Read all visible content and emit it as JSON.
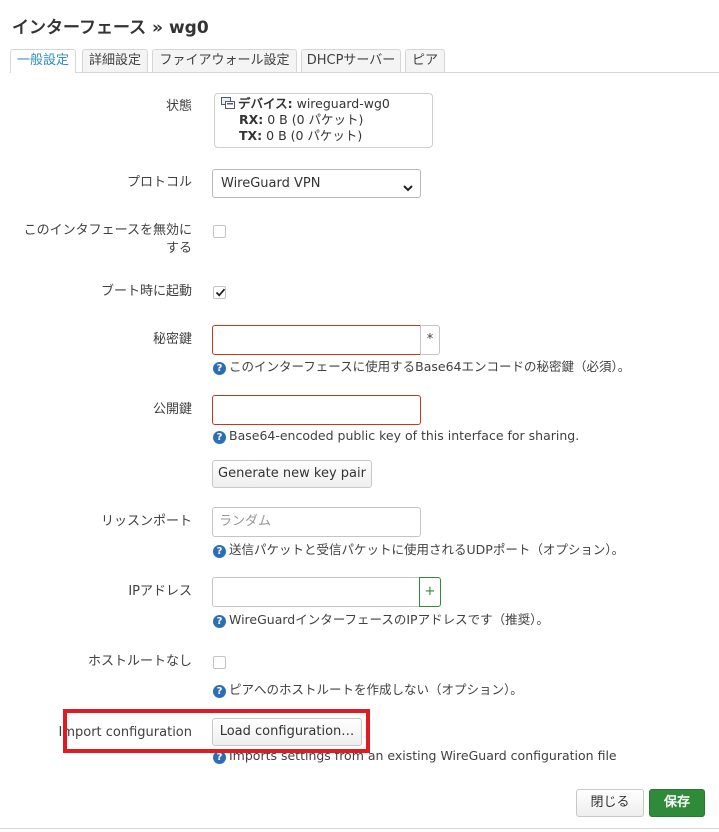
{
  "title": "インターフェース » wg0",
  "tabs": [
    {
      "label": "一般設定",
      "active": true
    },
    {
      "label": "詳細設定",
      "active": false
    },
    {
      "label": "ファイアウォール設定",
      "active": false
    },
    {
      "label": "DHCPサーバー",
      "active": false
    },
    {
      "label": "ピア",
      "active": false
    }
  ],
  "status": {
    "label": "状態",
    "device_key": "デバイス:",
    "device_value": "wireguard-wg0",
    "rx_key": "RX:",
    "rx_value": "0 B (0 パケット)",
    "tx_key": "TX:",
    "tx_value": "0 B (0 パケット)",
    "icon": "network-device-icon"
  },
  "protocol": {
    "label": "プロトコル",
    "value": "WireGuard VPN"
  },
  "disable": {
    "label_line1": "このインタフェースを無効に",
    "label_line2": "する",
    "checked": false
  },
  "boot": {
    "label": "ブート時に起動",
    "checked": true
  },
  "private_key": {
    "label": "秘密鍵",
    "value": "",
    "addon": "*",
    "help": "このインターフェースに使用するBase64エンコードの秘密鍵（必須）。"
  },
  "public_key": {
    "label": "公開鍵",
    "value": "",
    "help": "Base64-encoded public key of this interface for sharing."
  },
  "generate_button": "Generate new key pair",
  "listen_port": {
    "label": "リッスンポート",
    "placeholder": "ランダム",
    "help": "送信パケットと受信パケットに使用されるUDPポート（オプション）。"
  },
  "ip_address": {
    "label": "IPアドレス",
    "value": "",
    "addon": "+",
    "help": "WireGuardインターフェースのIPアドレスです（推奨）。"
  },
  "no_host_route": {
    "label": "ホストルートなし",
    "checked": false,
    "help": "ピアへのホストルートを作成しない（オプション）。"
  },
  "import_config": {
    "label": "Import configuration",
    "button": "Load configuration…",
    "help": "Imports settings from an existing WireGuard configuration file"
  },
  "footer": {
    "close_label": "閉じる",
    "save_label": "保存"
  },
  "colors": {
    "accent": "#2c8ec6",
    "save": "#2f8a3a",
    "error_border": "#c0391b",
    "highlight": "#e01b22",
    "help_icon": "#2a6fb5"
  }
}
